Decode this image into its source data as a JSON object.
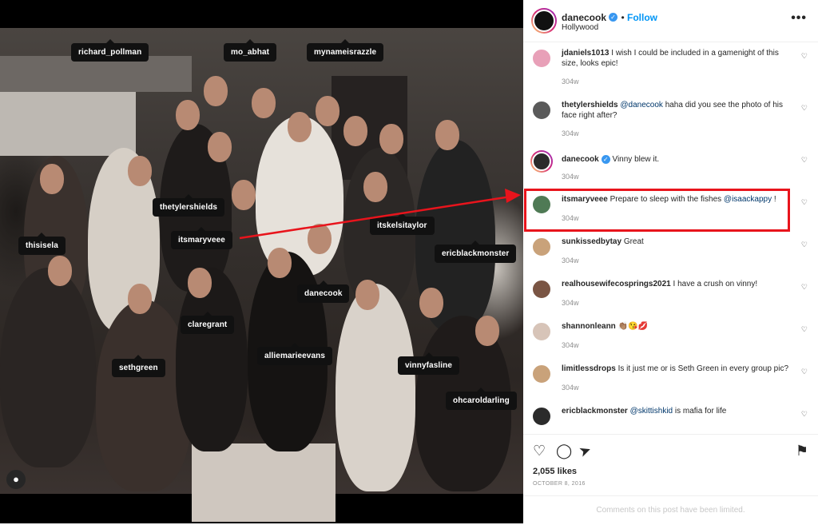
{
  "post": {
    "username": "danecook",
    "follow_label": "Follow",
    "location": "Hollywood",
    "more_label": "•••",
    "likes": "2,055 likes",
    "date": "OCTOBER 8, 2016",
    "comments_limited": "Comments on this post have been limited."
  },
  "photo_tags": {
    "richard_pollman": "richard_pollman",
    "mo_abhat": "mo_abhat",
    "mynameisrazzle": "mynameisrazzle",
    "thetylershields": "thetylershields",
    "itsmaryveee": "itsmaryveee",
    "itskelsitaylor": "itskelsitaylor",
    "thisisela": "thisisela",
    "ericblackmonster": "ericblackmonster",
    "danecook": "danecook",
    "claregrant": "claregrant",
    "alliemarieevans": "alliemarieevans",
    "sethgreen": "sethgreen",
    "vinnyfasline": "vinnyfasline",
    "ohcaroldarling": "ohcaroldarling"
  },
  "comments": [
    {
      "user": "jdaniels1013",
      "text": "I wish I could be included in a gamenight of this size, looks epic!",
      "time": "304w"
    },
    {
      "user": "thetylershields",
      "mention": "@danecook",
      "text": "haha did you see the photo of his face right after?",
      "time": "304w"
    },
    {
      "user": "danecook",
      "text": "Vinny blew it.",
      "time": "304w"
    },
    {
      "user": "itsmaryveee",
      "text": "Prepare to sleep with the fishes",
      "mention": "@isaackappy",
      "suffix": "!",
      "time": "304w"
    },
    {
      "user": "sunkissedbytay",
      "text": "Great",
      "time": "304w"
    },
    {
      "user": "realhousewifecosprings2021",
      "text": "I have a crush on vinny!",
      "time": "304w"
    },
    {
      "user": "shannonleann",
      "text": "👏🏽😘💋",
      "time": "304w"
    },
    {
      "user": "limitlessdrops",
      "text": "Is it just me or is Seth Green in every group pic?",
      "time": "304w"
    },
    {
      "user": "ericblackmonster",
      "mention": "@skittishkid",
      "text": "is mafia for life",
      "time": ""
    }
  ],
  "icons": {
    "heart": "♡",
    "comment": "◯",
    "share": "➤",
    "save": "⚑",
    "user": "●",
    "verified": "✓"
  },
  "colors": {
    "accent": "#0095f6",
    "verified": "#3897f0",
    "highlight": "#e8141c"
  }
}
